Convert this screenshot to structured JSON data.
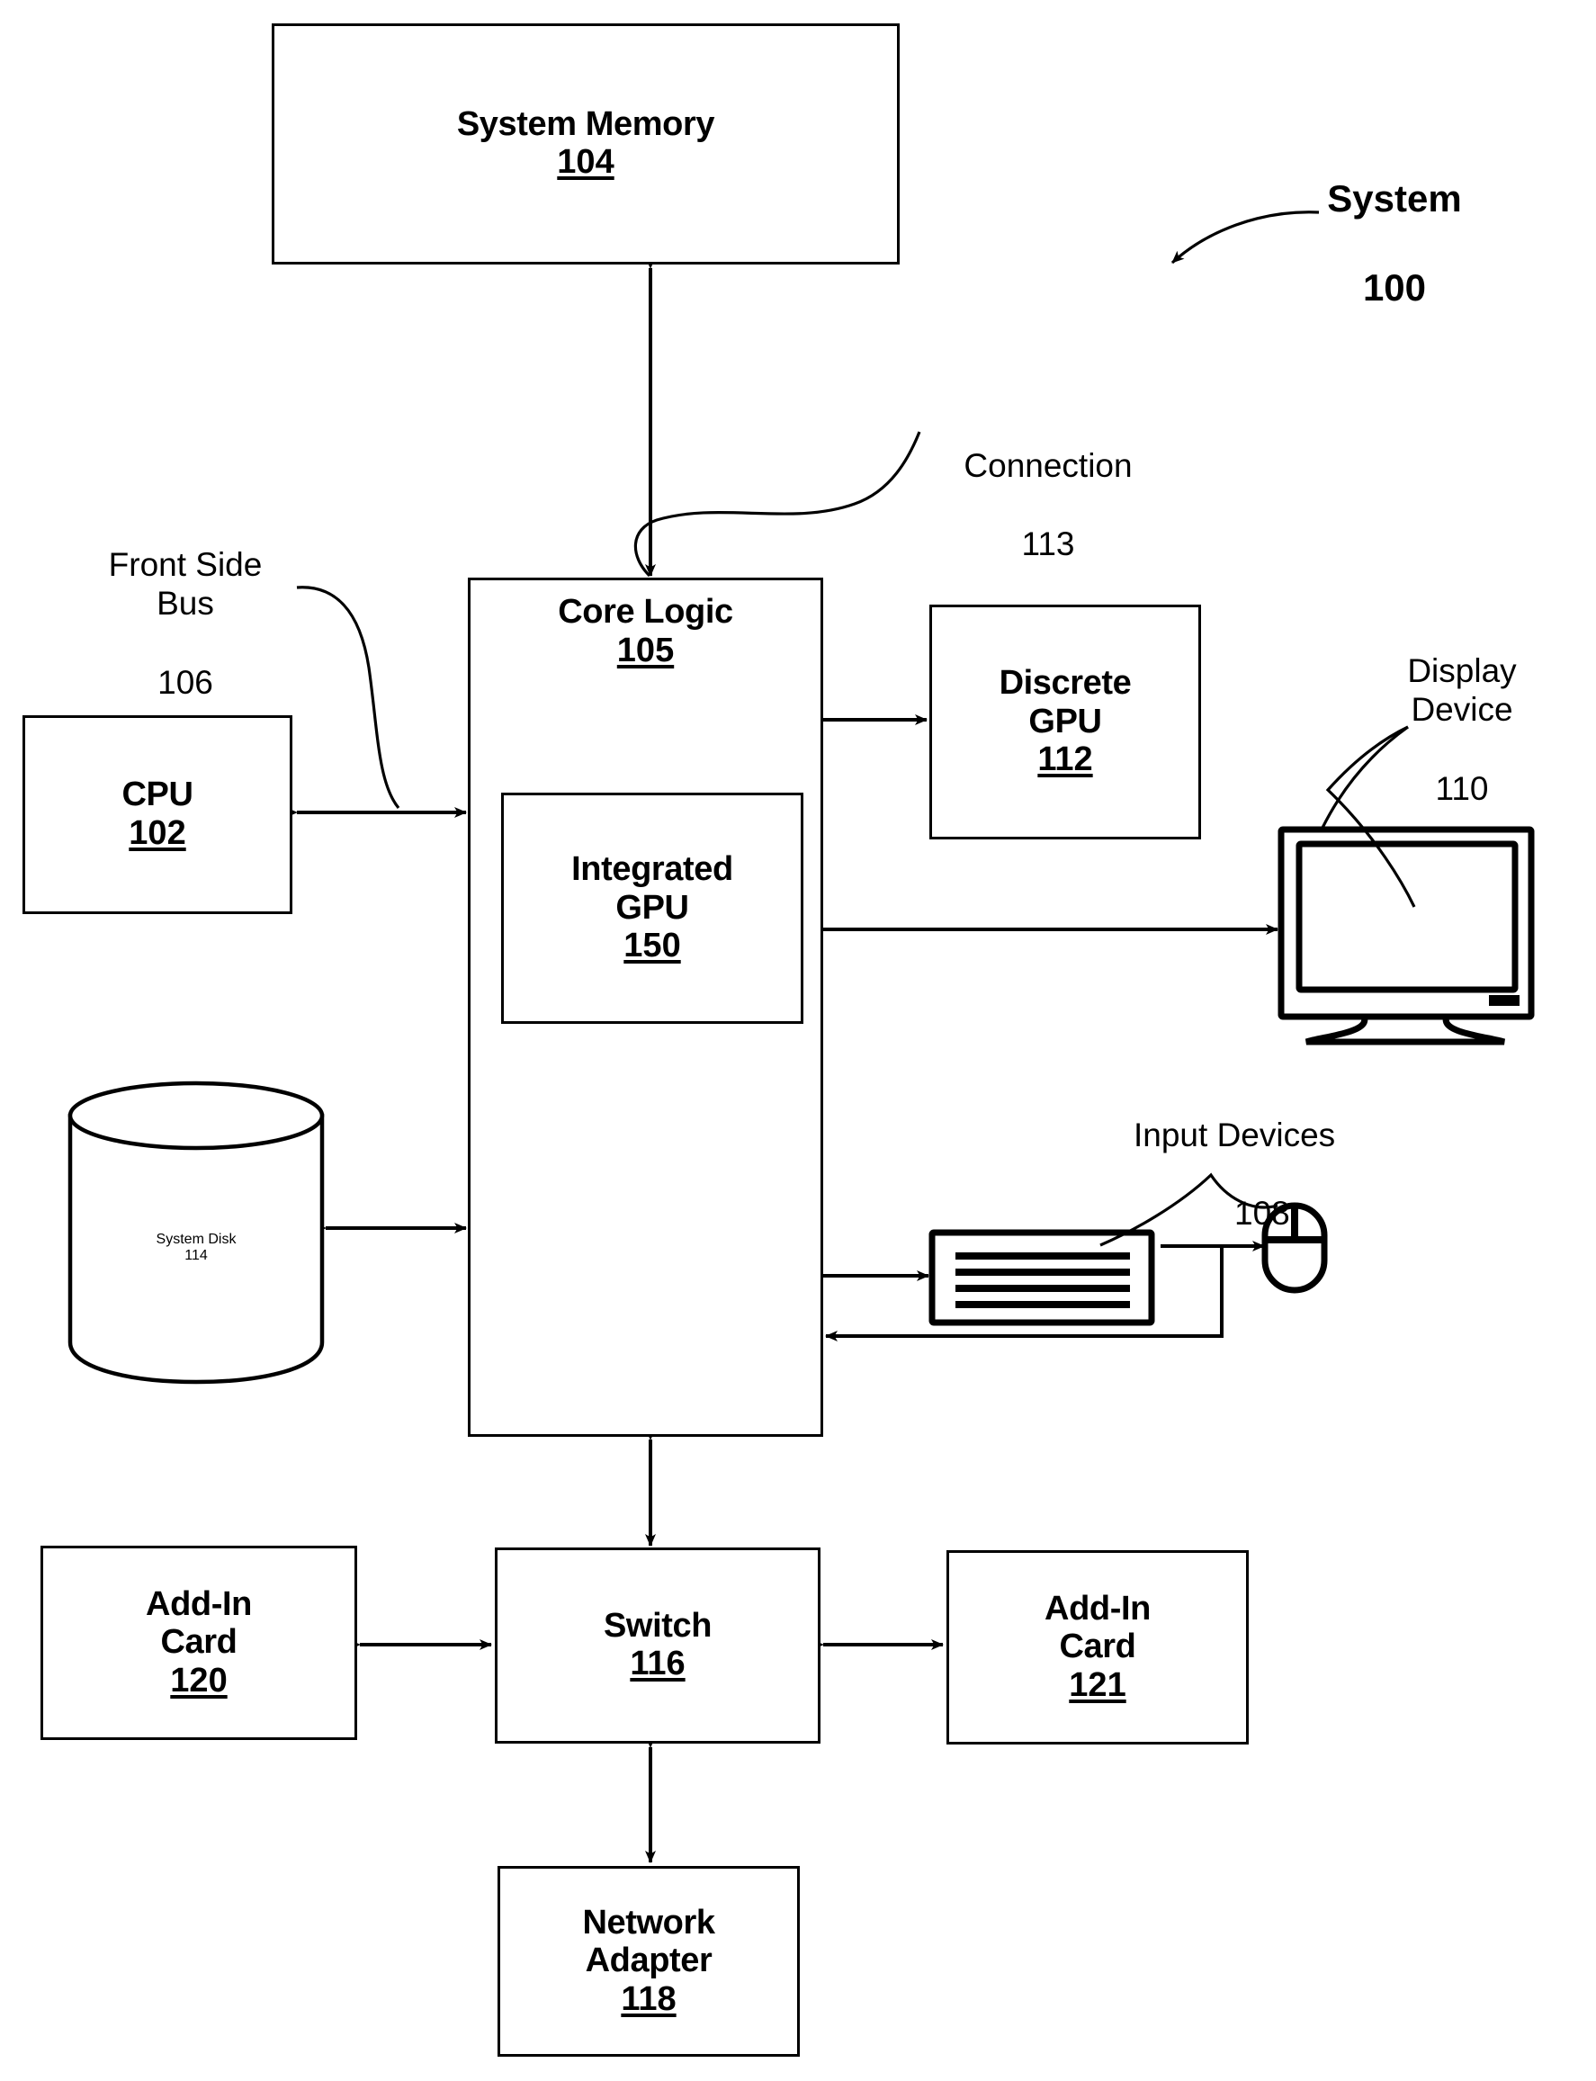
{
  "figure": {
    "title_label": "System",
    "title_number": "100"
  },
  "blocks": {
    "system_memory": {
      "title": "System Memory",
      "number": "104"
    },
    "core_logic": {
      "title": "Core Logic",
      "number": "105"
    },
    "integrated_gpu": {
      "title": "Integrated\nGPU",
      "number": "150"
    },
    "discrete_gpu": {
      "title": "Discrete\nGPU",
      "number": "112"
    },
    "cpu": {
      "title": "CPU",
      "number": "102"
    },
    "system_disk": {
      "title": "System\nDisk",
      "number": "114"
    },
    "switch": {
      "title": "Switch",
      "number": "116"
    },
    "add_in_card_left": {
      "title": "Add-In\nCard",
      "number": "120"
    },
    "add_in_card_right": {
      "title": "Add-In\nCard",
      "number": "121"
    },
    "network_adapter": {
      "title": "Network\nAdapter",
      "number": "118"
    }
  },
  "callouts": {
    "connection": {
      "text": "Connection",
      "number": "113"
    },
    "front_side_bus": {
      "text": "Front Side\nBus",
      "number": "106"
    },
    "display_device": {
      "text": "Display\nDevice",
      "number": "110"
    },
    "input_devices": {
      "text": "Input Devices",
      "number": "108"
    }
  },
  "icons": {
    "monitor": "display-monitor-icon",
    "keyboard": "keyboard-icon",
    "mouse": "mouse-icon",
    "disk_cylinder": "cylinder-disk-icon"
  },
  "colors": {
    "stroke": "#000000",
    "background": "#ffffff"
  }
}
